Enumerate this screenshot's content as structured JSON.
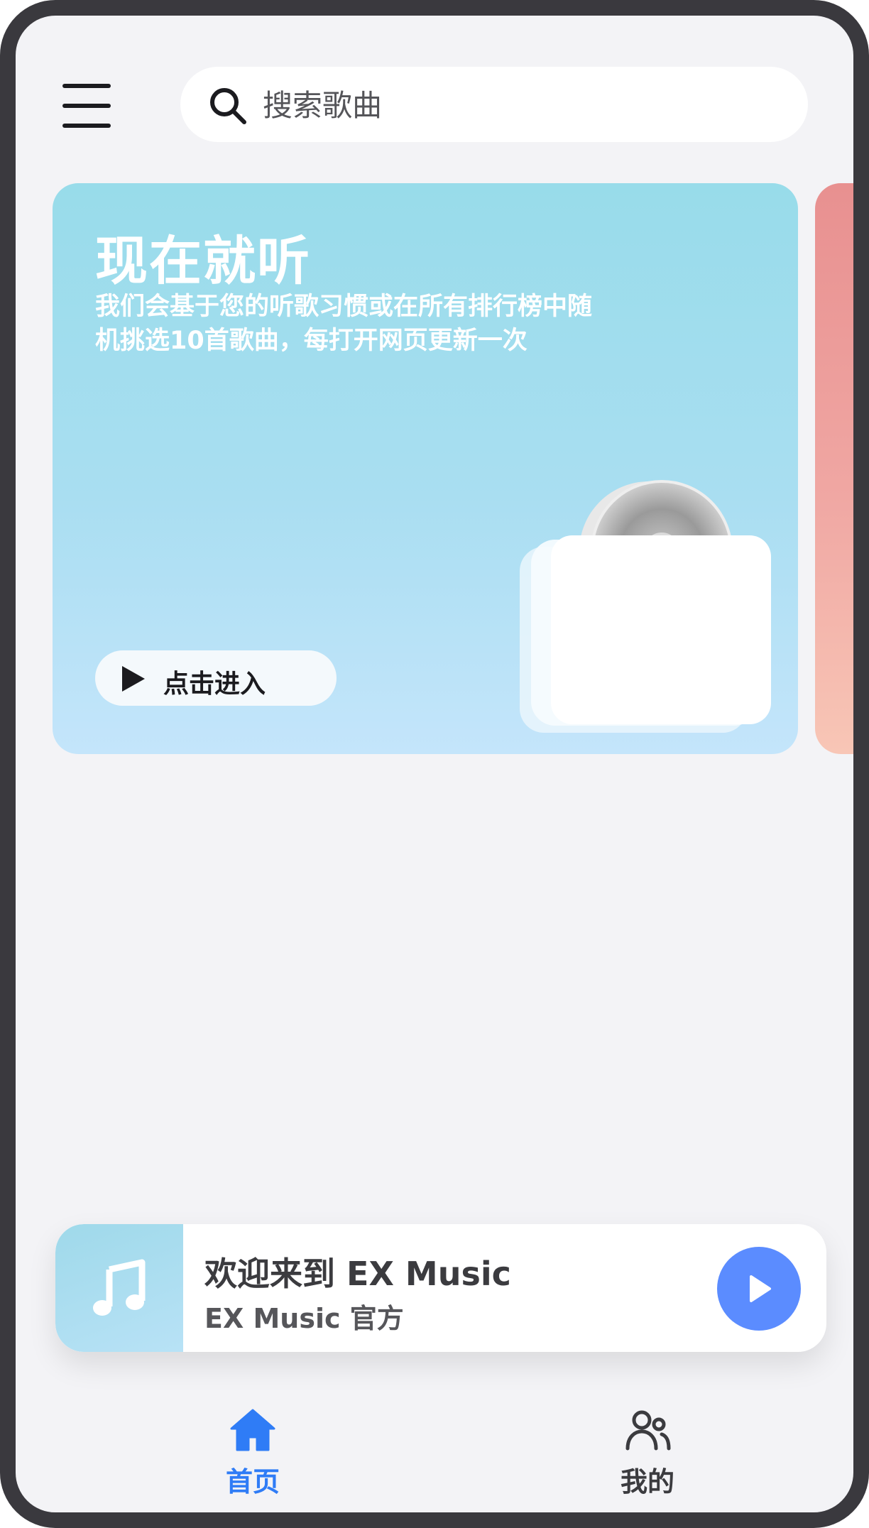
{
  "header": {
    "search_placeholder": "搜索歌曲",
    "menu_icon": "hamburger-menu-icon",
    "search_icon": "search-icon"
  },
  "banner": {
    "title": "现在就听",
    "description": "我们会基于您的听歌习惯或在所有排行榜中随机挑选10首歌曲，每打开网页更新一次",
    "button_label": "点击进入",
    "button_icon": "play-icon",
    "illustration": "vinyl-records-illustration"
  },
  "player": {
    "title": "欢迎来到 EX Music",
    "artist": "EX Music 官方",
    "cover_icon": "music-note-icon",
    "play_icon": "play-icon"
  },
  "bottom_nav": {
    "items": [
      {
        "label": "首页",
        "icon": "home-icon",
        "active": true
      },
      {
        "label": "我的",
        "icon": "users-icon",
        "active": false
      }
    ]
  },
  "colors": {
    "accent": "#2f7cf6",
    "play_button": "#5b8cff",
    "banner_primary": "#98dcea",
    "banner_secondary": "#e89090",
    "background": "#f3f3f6"
  }
}
